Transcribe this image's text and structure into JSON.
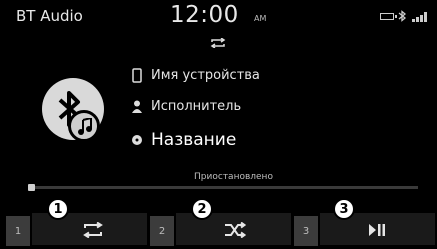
{
  "status_bar": {
    "source": "BT Audio",
    "time": "12:00",
    "ampm": "AM",
    "icons": [
      "battery-icon",
      "bluetooth-icon",
      "signal-icon"
    ]
  },
  "track": {
    "device_name": "Имя устройства",
    "artist": "Исполнитель",
    "title": "Название",
    "status": "Приостановлено",
    "progress": 0.0
  },
  "controls": [
    {
      "number": "1",
      "icon": "repeat-icon",
      "callout": "1"
    },
    {
      "number": "2",
      "icon": "shuffle-icon",
      "callout": "2"
    },
    {
      "number": "3",
      "icon": "play-pause-icon",
      "callout": "3"
    }
  ],
  "colors": {
    "background": "#000000",
    "text": "#e6e6e6",
    "button": "#1a1a1a",
    "tab": "#3c3c3c"
  }
}
